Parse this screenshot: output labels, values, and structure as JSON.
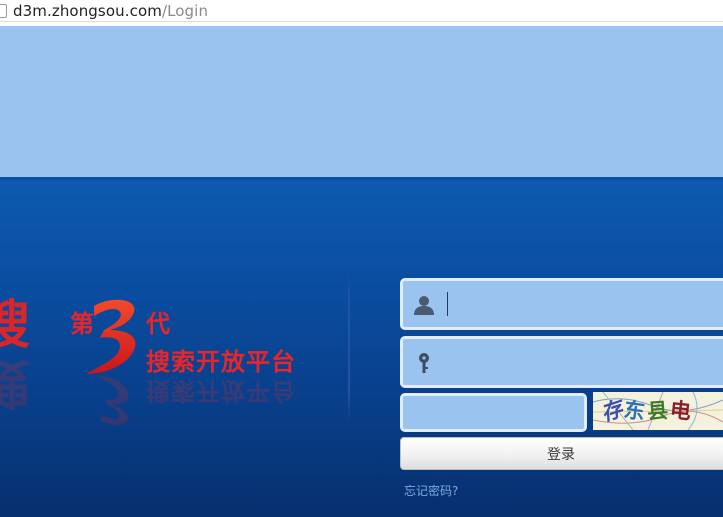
{
  "browser": {
    "url_host": "d3m.zhongsou.com",
    "url_path": "/Login"
  },
  "logo": {
    "brand_char": "搜",
    "generation_first": "第",
    "generation_number": "3",
    "generation_last": "代",
    "platform_text": "搜索开放平台"
  },
  "form": {
    "username_value": "",
    "password_value": "",
    "captcha_value": "",
    "captcha_chars": "存东县电",
    "login_button_label": "登录",
    "forgot_password_label": "忘记密码?"
  },
  "icons": {
    "username": "user-icon",
    "password": "key-icon",
    "page": "page-icon"
  },
  "colors": {
    "top_band": "#9ac3ef",
    "panel_blue": "#0a4c9f",
    "brand_red": "#e6262b",
    "field_fill": "#9ac3ef",
    "link": "#7fa9dc"
  }
}
